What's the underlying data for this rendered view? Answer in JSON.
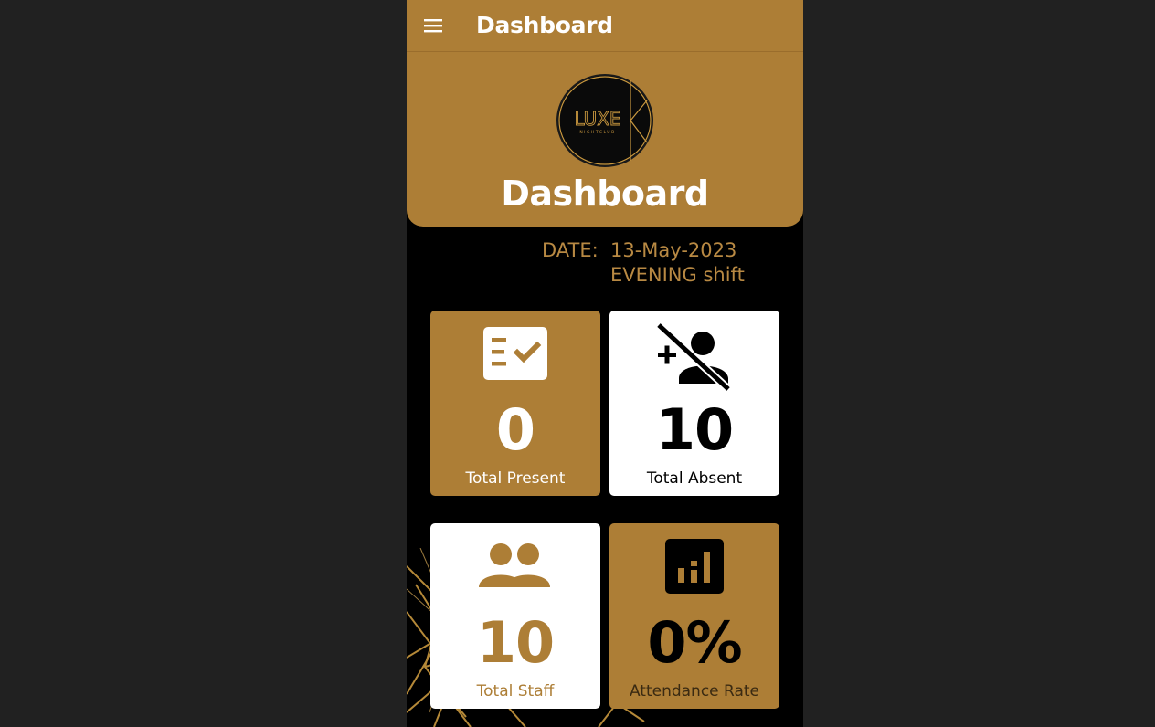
{
  "appbar": {
    "title": "Dashboard",
    "menu_icon": "hamburger-menu-icon"
  },
  "header": {
    "logo_text": "LUXE",
    "logo_subtext": "NIGHTCLUB",
    "title": "Dashboard"
  },
  "info": {
    "date_label": "DATE:",
    "date_value": "13-May-2023",
    "shift_value": "EVENING shift"
  },
  "tiles": [
    {
      "icon": "checklist-icon",
      "value": "0",
      "label": "Total Present"
    },
    {
      "icon": "person-off-icon",
      "value": "10",
      "label": "Total Absent"
    },
    {
      "icon": "group-icon",
      "value": "10",
      "label": "Total Staff"
    },
    {
      "icon": "bar-chart-icon",
      "value": "0%",
      "label": "Attendance Rate"
    }
  ],
  "colors": {
    "gold": "#ad7e36",
    "date_text": "#b88943",
    "background": "#000000",
    "outer": "#212121",
    "white": "#ffffff"
  }
}
